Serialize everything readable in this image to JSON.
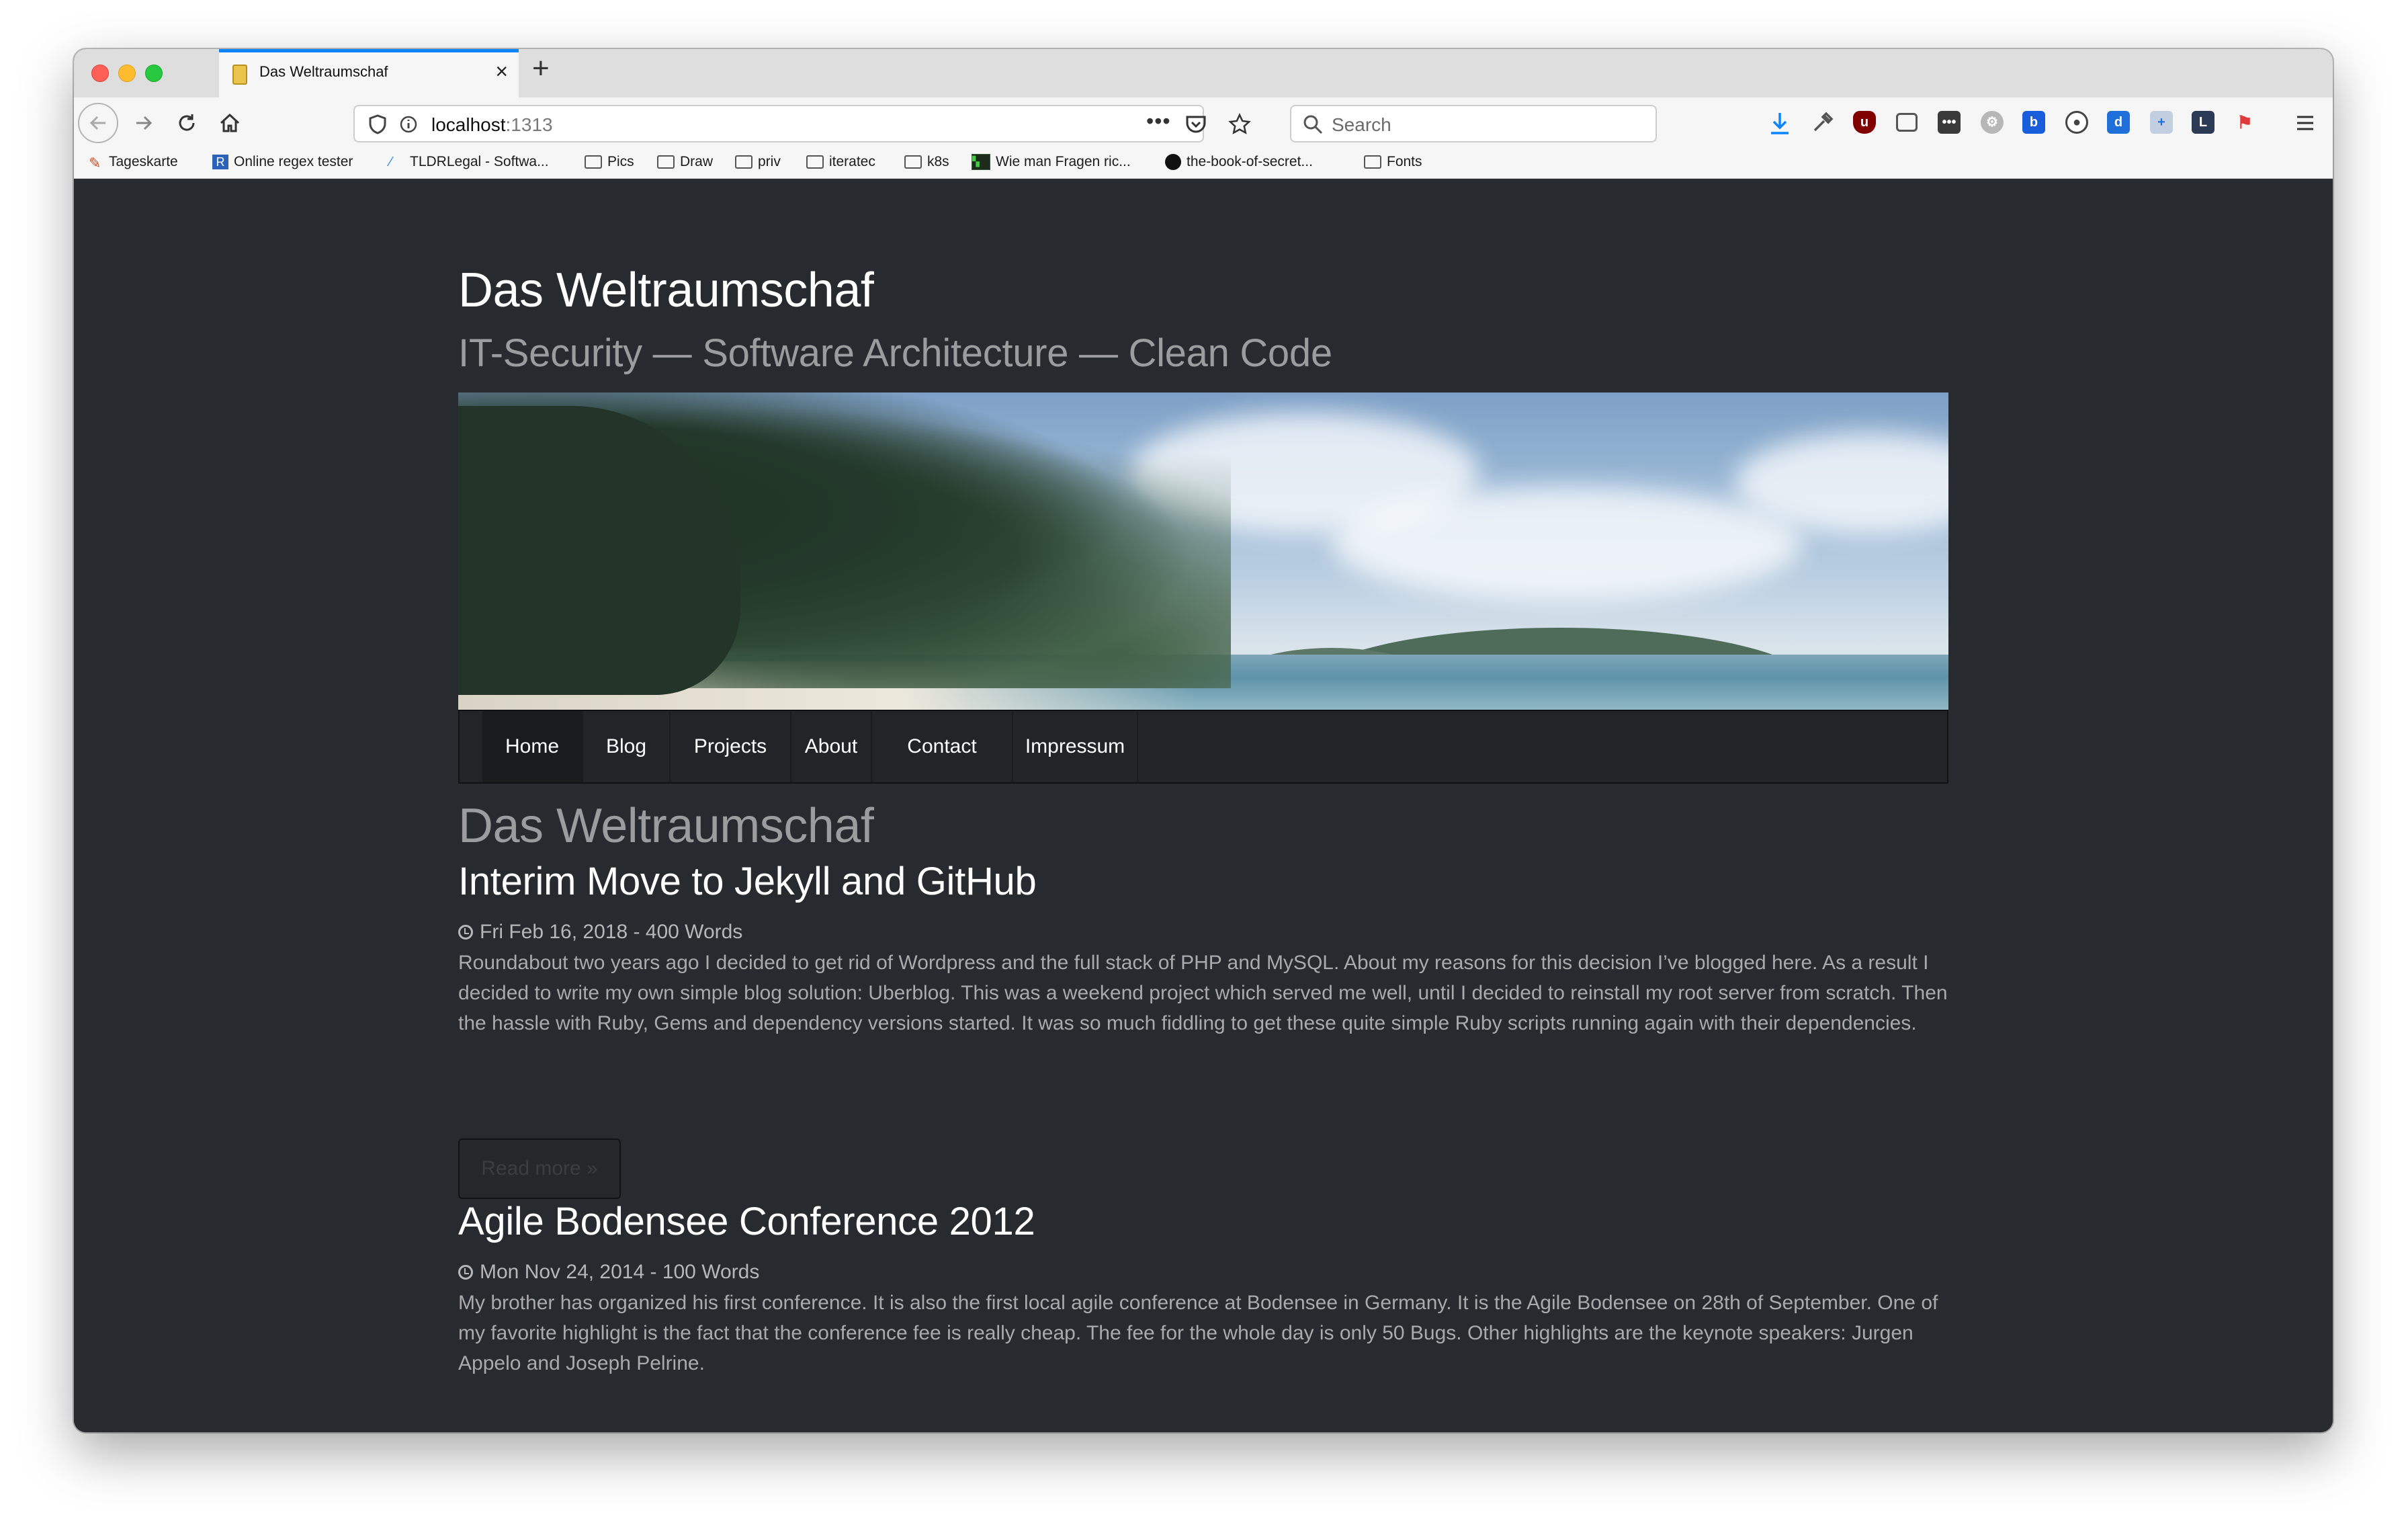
{
  "browser": {
    "tab": {
      "title": "Das Weltraumschaf"
    },
    "url": {
      "host": "localhost",
      "port": ":1313"
    },
    "search": {
      "placeholder": "Search"
    },
    "bookmarks": [
      {
        "label": "Tageskarte",
        "icon": "kitchen-icon"
      },
      {
        "label": "Online regex tester",
        "icon": "regex-icon"
      },
      {
        "label": "TLDRLegal - Softwa...",
        "icon": "tldrlegal-icon"
      },
      {
        "label": "Pics",
        "icon": "folder-icon"
      },
      {
        "label": "Draw",
        "icon": "folder-icon"
      },
      {
        "label": "priv",
        "icon": "folder-icon"
      },
      {
        "label": "iteratec",
        "icon": "folder-icon"
      },
      {
        "label": "k8s",
        "icon": "folder-icon"
      },
      {
        "label": "Wie man Fragen ric...",
        "icon": "terminal-icon"
      },
      {
        "label": "the-book-of-secret...",
        "icon": "github-icon"
      },
      {
        "label": "Fonts",
        "icon": "folder-icon"
      }
    ]
  },
  "site": {
    "title": "Das Weltraumschaf",
    "subtitle": "IT-Security — Software Architecture — Clean Code",
    "nav": [
      {
        "label": "Home",
        "active": true
      },
      {
        "label": "Blog",
        "active": false
      },
      {
        "label": "Projects",
        "active": false
      },
      {
        "label": "About",
        "active": false
      },
      {
        "label": "Contact",
        "active": false
      },
      {
        "label": "Impressum",
        "active": false
      }
    ],
    "page_heading": "Das Weltraumschaf",
    "read_more": "Read more »",
    "posts": [
      {
        "title": "Interim Move to Jekyll and GitHub",
        "meta": "Fri Feb 16, 2018 - 400 Words",
        "body": "Roundabout two years ago I decided to get rid of Wordpress and the full stack of PHP and MySQL. About my reasons for this decision I’ve blogged here. As a result I decided to write my own simple blog solution: Uberblog. This was a weekend project which served me well, until I decided to reinstall my root server from scratch. Then the hassle with Ruby, Gems and dependency versions started. It was so much fiddling to get these quite simple Ruby scripts running again with their dependencies."
      },
      {
        "title": "Agile Bodensee Conference 2012",
        "meta": "Mon Nov 24, 2014 - 100 Words",
        "body": "My brother has organized his first conference. It is also the first local agile conference at Bodensee in Germany. It is the Agile Bodensee on 28th of September. One of my favorite highlight is the fact that the conference fee is really cheap. The fee for the whole day is only 50 Bugs. Other highlights are the keynote speakers: Jurgen Appelo and Joseph Pelrine."
      }
    ]
  },
  "colors": {
    "page_bg": "#272a2e",
    "menu_bg": "#222427",
    "tab_accent": "#0a84ff"
  }
}
